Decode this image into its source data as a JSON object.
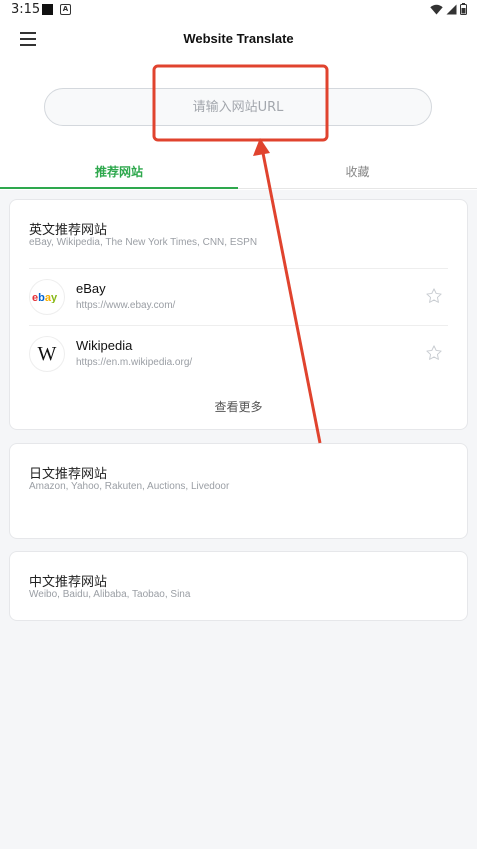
{
  "status_bar": {
    "time": "3:15",
    "icons": [
      "notification-square-icon",
      "a-icon",
      "wifi-icon",
      "signal-icon",
      "battery-icon"
    ]
  },
  "app_bar": {
    "title": "Website Translate",
    "menu_icon": "hamburger-menu-icon"
  },
  "search": {
    "placeholder": "请输入网站URL",
    "value": ""
  },
  "tabs": [
    {
      "label": "推荐网站",
      "active": true
    },
    {
      "label": "收藏",
      "active": false
    }
  ],
  "sections": [
    {
      "title": "英文推荐网站",
      "subtitle": "eBay, Wikipedia, The New York Times, CNN, ESPN",
      "sites": [
        {
          "name": "eBay",
          "url": "https://www.ebay.com/",
          "logo": "ebay-logo"
        },
        {
          "name": "Wikipedia",
          "url": "https://en.m.wikipedia.org/",
          "logo": "wikipedia-logo",
          "logo_text": "W"
        }
      ],
      "see_more": "查看更多"
    },
    {
      "title": "日文推荐网站",
      "subtitle": "Amazon, Yahoo, Rakuten, Auctions, Livedoor"
    },
    {
      "title": "中文推荐网站",
      "subtitle": "Weibo, Baidu, Alibaba, Taobao, Sina"
    }
  ],
  "colors": {
    "accent": "#2ea84d",
    "annotation": "#e0432e",
    "background": "#f5f6f8"
  }
}
